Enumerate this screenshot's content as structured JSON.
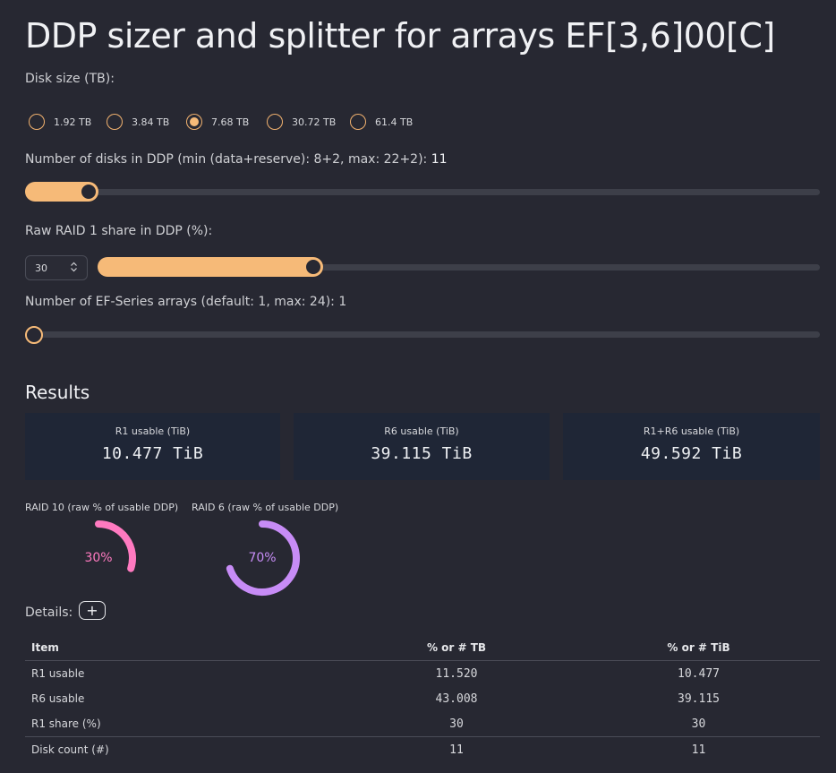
{
  "title": "DDP sizer and splitter for arrays EF[3,6]00[C]",
  "disk_size": {
    "label": "Disk size (TB):",
    "options": [
      "1.92 TB",
      "3.84 TB",
      "7.68 TB",
      "30.72 TB",
      "61.4 TB"
    ],
    "selected": "7.68 TB"
  },
  "disks_slider": {
    "label": "Number of disks in DDP (min (data+reserve): 8+2, max: 22+2):",
    "value": "11",
    "min": 10,
    "max": 24,
    "numeric_value": 11
  },
  "raid1_share": {
    "label": "Raw RAID 1 share in DDP (%):",
    "input_value": "30",
    "stepper_icon": "up-down-chevron-icon",
    "fraction": 0.3
  },
  "arrays_slider": {
    "label": "Number of EF-Series arrays (default: 1, max: 24): 1",
    "min": 1,
    "max": 24,
    "numeric_value": 1
  },
  "results": {
    "heading": "Results",
    "cards": [
      {
        "title": "R1 usable (TiB)",
        "value": "10.477 TiB"
      },
      {
        "title": "R6 usable (TiB)",
        "value": "39.115 TiB"
      },
      {
        "title": "R1+R6 usable (TiB)",
        "value": "49.592 TiB"
      }
    ]
  },
  "gauges": [
    {
      "label": "RAID 10 (raw % of usable DDP)",
      "value_text": "30%",
      "percent": 30,
      "color": "#ff7ac0"
    },
    {
      "label": "RAID 6 (raw % of usable DDP)",
      "value_text": "70%",
      "percent": 70,
      "color": "#c78cf6"
    }
  ],
  "details": {
    "label": "Details:",
    "button_label": "+",
    "columns": [
      "Item",
      "% or # TB",
      "% or # TiB"
    ],
    "rows": [
      [
        "R1 usable",
        "11.520",
        "10.477"
      ],
      [
        "R6 usable",
        "43.008",
        "39.115"
      ],
      [
        "R1 share (%)",
        "30",
        "30"
      ],
      [
        "Disk count (#)",
        "11",
        "11"
      ]
    ]
  },
  "colors": {
    "accent": "#f6ba78",
    "background": "#272832",
    "card": "#1f2636",
    "raid10": "#ff7ac0",
    "raid6": "#c78cf6"
  }
}
